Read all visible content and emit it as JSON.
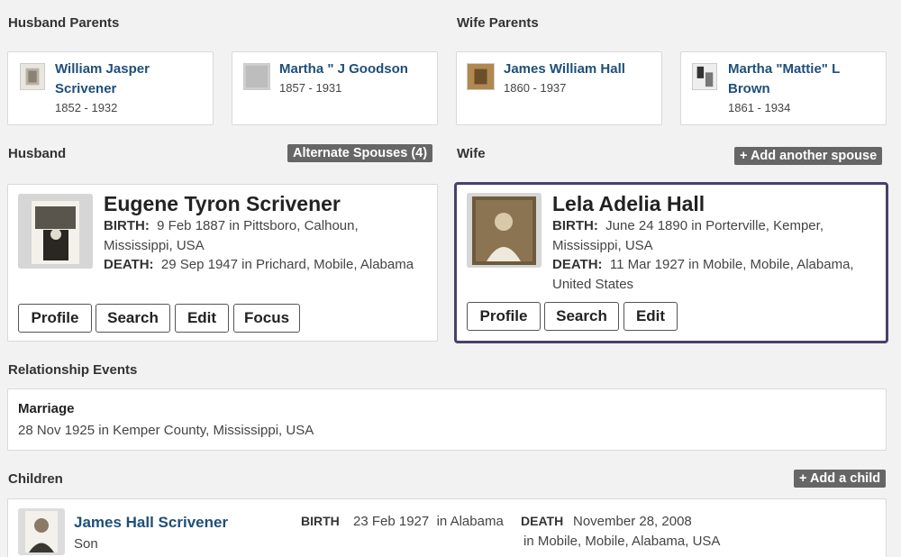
{
  "husband_parents": {
    "title": "Husband Parents",
    "father": {
      "name_line1": "William Jasper",
      "name_line2": "Scrivener",
      "dates": "1852 - 1932"
    },
    "mother": {
      "name": "Martha \" J Goodson",
      "dates": "1857 - 1931"
    }
  },
  "wife_parents": {
    "title": "Wife Parents",
    "father": {
      "name": "James William Hall",
      "dates": "1860 - 1937"
    },
    "mother": {
      "name_line1": "Martha \"Mattie\" L",
      "name_line2": "Brown",
      "dates": "1861 - 1934"
    }
  },
  "husband": {
    "section_label": "Husband",
    "alternate_spouses_label": "Alternate Spouses (4)",
    "name": "Eugene Tyron Scrivener",
    "birth_label": "BIRTH:",
    "birth_line1": "9 Feb 1887 in Pittsboro, Calhoun,",
    "birth_line2": "Mississippi, USA",
    "death_label": "DEATH:",
    "death_line1": "29 Sep 1947 in Prichard, Mobile, Alabama",
    "buttons": {
      "profile": "Profile",
      "search": "Search",
      "edit": "Edit",
      "focus": "Focus"
    }
  },
  "wife": {
    "section_label": "Wife",
    "add_spouse_label": "+ Add another spouse",
    "name": "Lela Adelia Hall",
    "birth_label": "BIRTH:",
    "birth_line1": "June 24 1890 in Porterville, Kemper,",
    "birth_line2": "Mississippi, USA",
    "death_label": "DEATH:",
    "death_line1": "11 Mar 1927 in Mobile, Mobile, Alabama,",
    "death_line2": "United States",
    "buttons": {
      "profile": "Profile",
      "search": "Search",
      "edit": "Edit"
    }
  },
  "relationship_events": {
    "title": "Relationship Events",
    "event_type": "Marriage",
    "event_detail": "28 Nov 1925 in Kemper County, Mississippi, USA"
  },
  "children": {
    "title": "Children",
    "add_child_label": "+ Add a child",
    "items": [
      {
        "name": "James Hall Scrivener",
        "relation": "Son",
        "birth_label": "BIRTH",
        "birth_value": "23 Feb 1927  in Alabama",
        "death_label": "DEATH",
        "death_line1": "November 28, 2008",
        "death_line2": "in Mobile, Mobile, Alabama, USA"
      }
    ]
  },
  "colors": {
    "link": "#1e4f7a",
    "badge_bg": "#666666",
    "selected_border": "#4a3f6b",
    "page_bg": "#f2f2f2"
  }
}
